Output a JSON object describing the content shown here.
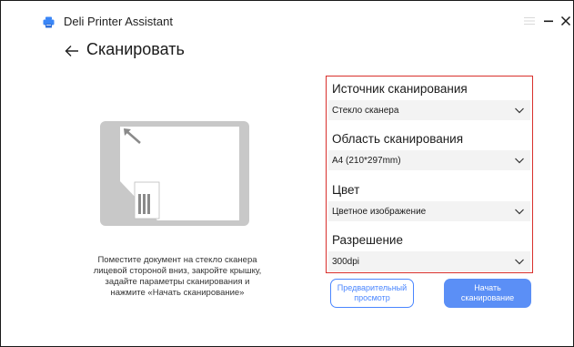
{
  "app": {
    "title": "Deli Printer Assistant"
  },
  "page": {
    "title": "Сканировать"
  },
  "instructions": "Поместите документ на стекло сканера лицевой стороной вниз, закройте крышку, задайте параметры сканирования и нажмите «Начать сканирование»",
  "settings": [
    {
      "label": "Источник сканирования",
      "value": "Стекло сканера"
    },
    {
      "label": "Область сканирования",
      "value": "A4 (210*297mm)"
    },
    {
      "label": "Цвет",
      "value": "Цветное изображение"
    },
    {
      "label": "Разрешение",
      "value": "300dpi"
    }
  ],
  "buttons": {
    "preview": "Предварительный\nпросмотр",
    "start": "Начать\nсканирование"
  },
  "colors": {
    "accent": "#4a86ff",
    "start_button": "#5b8ff6",
    "highlight_border": "#d9302c",
    "illustration": "#c8c8c8"
  }
}
